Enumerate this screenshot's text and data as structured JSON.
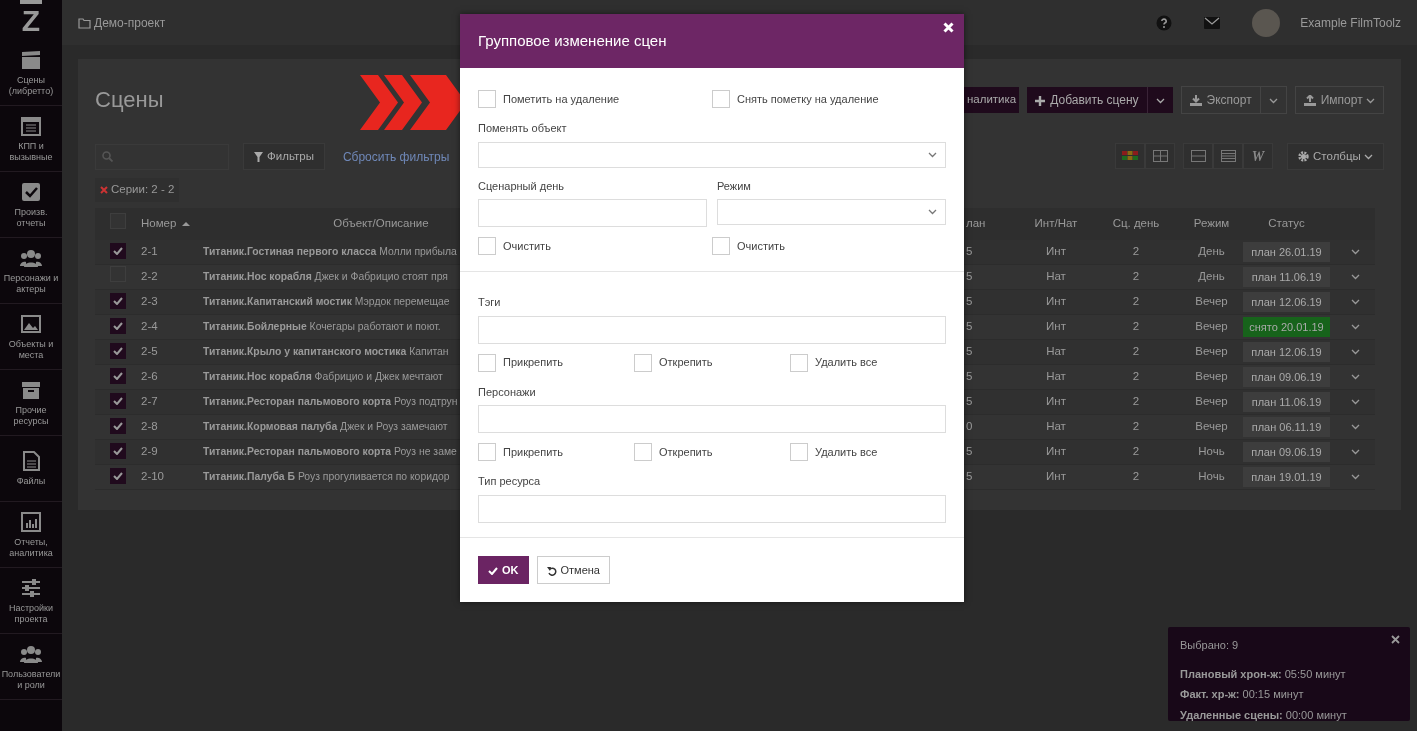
{
  "sidebar": {
    "logo": "Z",
    "items": [
      {
        "label": "Сцены (либретто)"
      },
      {
        "label": "КПП и вызывные"
      },
      {
        "label": "Произв. отчеты"
      },
      {
        "label": "Персонажи и актеры"
      },
      {
        "label": "Объекты и места"
      },
      {
        "label": "Прочие ресурсы"
      },
      {
        "label": "Файлы"
      },
      {
        "label": "Отчеты, аналитика"
      },
      {
        "label": "Настройки проекта"
      },
      {
        "label": "Пользователи и роли"
      }
    ]
  },
  "topbar": {
    "project": "Демо-проект",
    "user": "Example FilmToolz"
  },
  "page": {
    "title": "Сцены",
    "analytics_button": "налитика",
    "add_button": "Добавить сцену",
    "export_button": "Экспорт",
    "import_button": "Импорт",
    "filters_button": "Фильтры",
    "reset_link": "Сбросить фильтры",
    "view_text_button": "W",
    "columns_button": "Столбцы",
    "filter_chip": "Серии: 2 - 2"
  },
  "table": {
    "header_checked": false,
    "columns": [
      {
        "label": "Номер",
        "sorted": true
      },
      {
        "label": "Объект/Описание",
        "sorted": false
      },
      {
        "label": "лан",
        "sorted": false
      },
      {
        "label": "Инт/Нат",
        "sorted": false
      },
      {
        "label": "Сц. день",
        "sorted": false
      },
      {
        "label": "Режим",
        "sorted": false
      },
      {
        "label": "Статус",
        "sorted": false
      }
    ],
    "rows": [
      {
        "checked": true,
        "number": "2-1",
        "description": "**Титаник.Гостиная первого класса** Молли прибыла",
        "column_4": "5",
        "int_nat": "Инт",
        "day": "2",
        "mode": "День",
        "status": "план 26.01.19",
        "color": "#3d3d3d"
      },
      {
        "checked": false,
        "number": "2-2",
        "description": "**Титаник.Нос корабля** Джек и Фабрицио стоят пря",
        "column_4": "5",
        "int_nat": "Нат",
        "day": "2",
        "mode": "День",
        "status": "план 11.06.19",
        "color": "#3d3d3d"
      },
      {
        "checked": true,
        "number": "2-3",
        "description": "**Титаник.Капитанский мостик** Мэрдок перемещае",
        "column_4": "5",
        "int_nat": "Инт",
        "day": "2",
        "mode": "Вечер",
        "status": "план 12.06.19",
        "color": "#3d3d3d"
      },
      {
        "checked": true,
        "number": "2-4",
        "description": "**Титаник.Бойлерные** Кочегары работают и поют.",
        "column_4": "5",
        "int_nat": "Инт",
        "day": "2",
        "mode": "Вечер",
        "status": "снято 20.01.19",
        "color": "#17631b"
      },
      {
        "checked": true,
        "number": "2-5",
        "description": "**Титаник.Крыло у капитанского мостика** Капитан",
        "column_4": "5",
        "int_nat": "Нат",
        "day": "2",
        "mode": "Вечер",
        "status": "план 12.06.19",
        "color": "#3d3d3d"
      },
      {
        "checked": true,
        "number": "2-6",
        "description": "**Титаник.Нос корабля** Фабрицио и Джек мечтают",
        "column_4": "5",
        "int_nat": "Нат",
        "day": "2",
        "mode": "Вечер",
        "status": "план 09.06.19",
        "color": "#3d3d3d"
      },
      {
        "checked": true,
        "number": "2-7",
        "description": "**Титаник.Ресторан пальмового корта** Роуз подтрун",
        "column_4": "5",
        "int_nat": "Инт",
        "day": "2",
        "mode": "Вечер",
        "status": "план 11.06.19",
        "color": "#3d3d3d"
      },
      {
        "checked": true,
        "number": "2-8",
        "description": "**Титаник.Кормовая палуба** Джек и Роуз замечают",
        "column_4": "0",
        "int_nat": "Нат",
        "day": "2",
        "mode": "Вечер",
        "status": "план 06.11.19",
        "color": "#3d3d3d"
      },
      {
        "checked": true,
        "number": "2-9",
        "description": "**Титаник.Ресторан пальмового корта** Роуз не заме",
        "column_4": "5",
        "int_nat": "Инт",
        "day": "2",
        "mode": "Ночь",
        "status": "план 09.06.19",
        "color": "#3d3d3d"
      },
      {
        "checked": true,
        "number": "2-10",
        "description": "**Титаник.Палуба Б** Роуз прогуливается по коридор",
        "column_4": "5",
        "int_nat": "Инт",
        "day": "2",
        "mode": "Ночь",
        "status": "план 19.01.19",
        "color": "#3d3d3d"
      }
    ]
  },
  "modal": {
    "title": "Групповое изменение сцен",
    "sections": [
      {
        "rows": [
          {
            "kind": "checks",
            "items": [
              {
                "label": "Пометить на удаление",
                "checked": false
              },
              {
                "label": "Снять пометку на удаление",
                "checked": false
              }
            ]
          },
          {
            "kind": "fields",
            "items": [
              {
                "kind": "select",
                "label": "Поменять объект"
              }
            ]
          },
          {
            "kind": "fields",
            "items": [
              {
                "kind": "input",
                "label": "Сценарный день"
              },
              {
                "kind": "select",
                "label": "Режим"
              }
            ]
          },
          {
            "kind": "checks",
            "items": [
              {
                "label": "Очистить",
                "checked": false
              },
              {
                "label": "Очистить",
                "checked": false
              }
            ]
          }
        ]
      },
      {
        "rows": [
          {
            "kind": "fields",
            "items": [
              {
                "kind": "input",
                "label": "Тэги"
              }
            ]
          },
          {
            "kind": "checks",
            "items": [
              {
                "label": "Прикрепить",
                "checked": false
              },
              {
                "label": "Открепить",
                "checked": false
              },
              {
                "label": "Удалить все",
                "checked": false
              }
            ]
          },
          {
            "kind": "fields",
            "items": [
              {
                "kind": "input",
                "label": "Персонажи"
              }
            ]
          },
          {
            "kind": "checks",
            "items": [
              {
                "label": "Прикрепить",
                "checked": false
              },
              {
                "label": "Открепить",
                "checked": false
              },
              {
                "label": "Удалить все",
                "checked": false
              }
            ]
          },
          {
            "kind": "fields",
            "items": [
              {
                "kind": "input",
                "label": "Тип ресурса"
              }
            ]
          }
        ]
      }
    ],
    "ok_button": "OK",
    "cancel_button": "Отмена"
  },
  "selection_panel": {
    "lines": [
      "Выбрано: 9",
      "**Плановый хрон-ж:** 05:50 минут",
      "**Факт. хр-ж:** 00:15 минут",
      "**Удаленные сцены:** 00:00 минут"
    ]
  }
}
